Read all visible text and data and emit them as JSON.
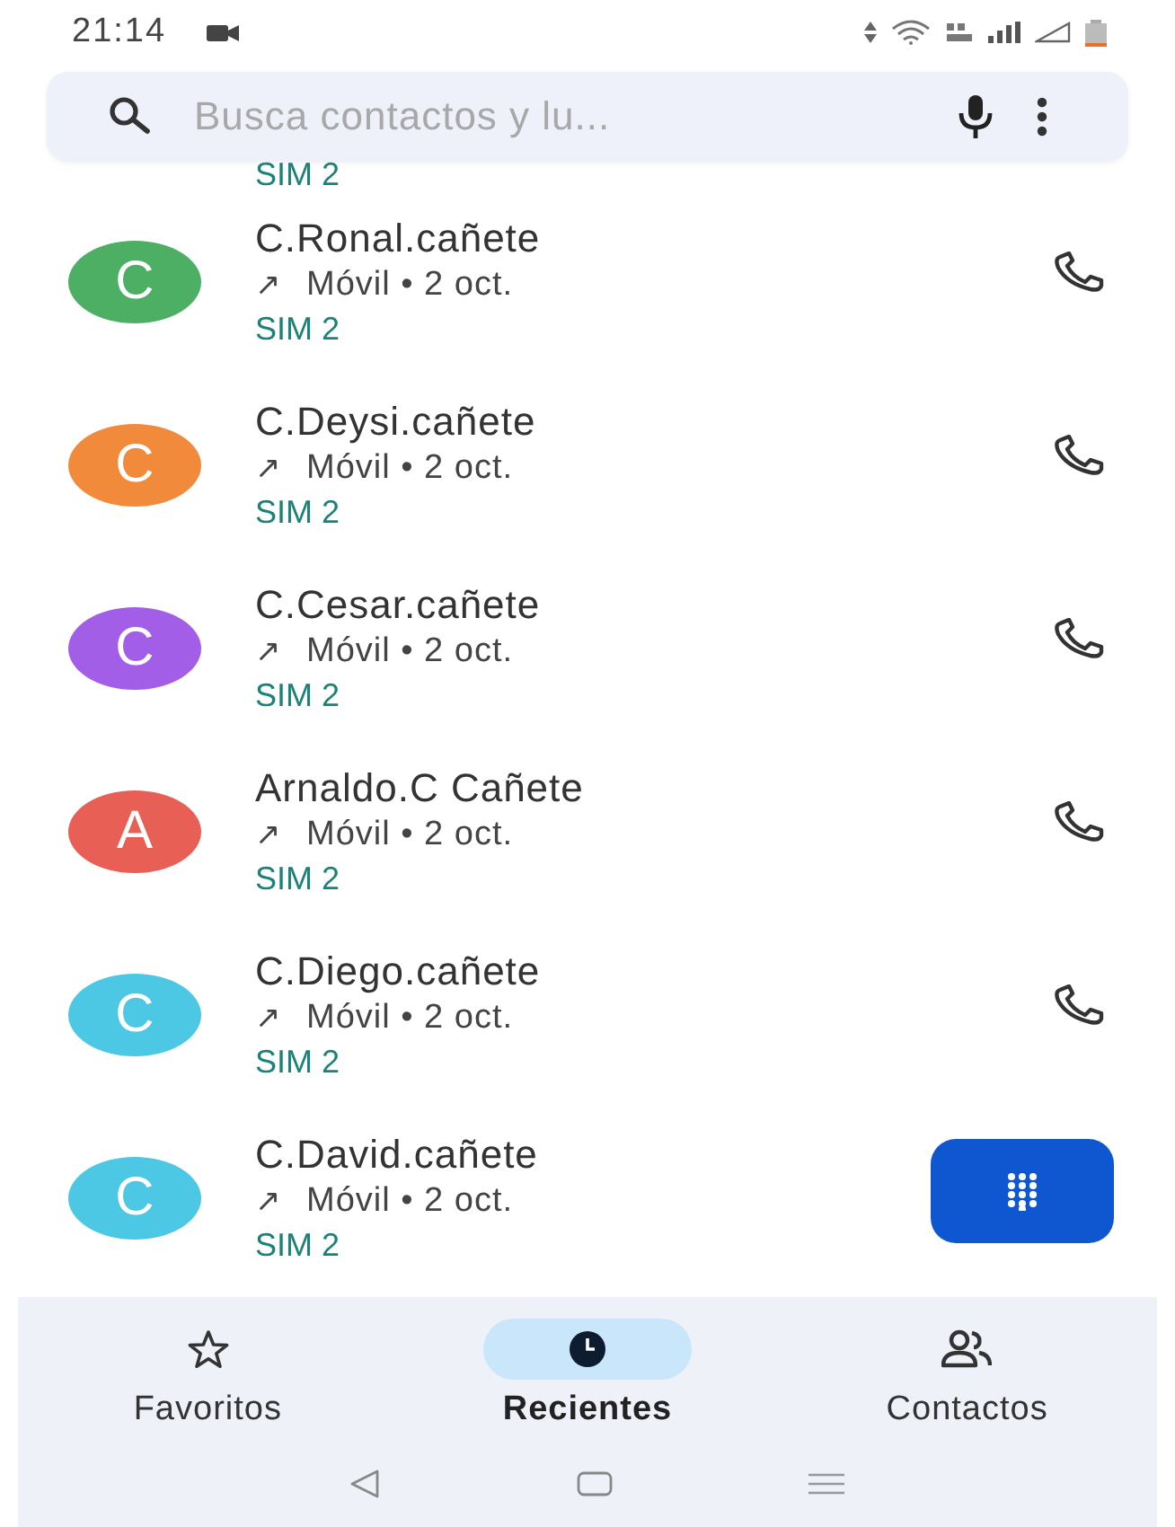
{
  "status_bar": {
    "time": "21:14"
  },
  "search": {
    "placeholder": "Busca contactos y lu..."
  },
  "partial_row": {
    "sim": "SIM 2"
  },
  "calls": [
    {
      "initial": "C",
      "color": "#4caf64",
      "name": "C.Ronal.cañete",
      "direction": "↗",
      "detail": "Móvil • 2 oct.",
      "sim": "SIM 2"
    },
    {
      "initial": "C",
      "color": "#f28a3c",
      "name": "C.Deysi.cañete",
      "direction": "↗",
      "detail": "Móvil • 2 oct.",
      "sim": "SIM 2"
    },
    {
      "initial": "C",
      "color": "#a35ee8",
      "name": "C.Cesar.cañete",
      "direction": "↗",
      "detail": "Móvil • 2 oct.",
      "sim": "SIM 2"
    },
    {
      "initial": "A",
      "color": "#e85f55",
      "name": "Arnaldo.C Cañete",
      "direction": "↗",
      "detail": "Móvil • 2 oct.",
      "sim": "SIM 2"
    },
    {
      "initial": "C",
      "color": "#4cc8e4",
      "name": "C.Diego.cañete",
      "direction": "↗",
      "detail": "Móvil • 2 oct.",
      "sim": "SIM 2"
    },
    {
      "initial": "C",
      "color": "#4cc8e4",
      "name": "C.David.cañete",
      "direction": "↗",
      "detail": "Móvil • 2 oct.",
      "sim": "SIM 2"
    }
  ],
  "tabs": [
    {
      "kind": "star",
      "label": "Favoritos",
      "selected": false
    },
    {
      "kind": "clock",
      "label": "Recientes",
      "selected": true
    },
    {
      "kind": "people",
      "label": "Contactos",
      "selected": false
    }
  ]
}
